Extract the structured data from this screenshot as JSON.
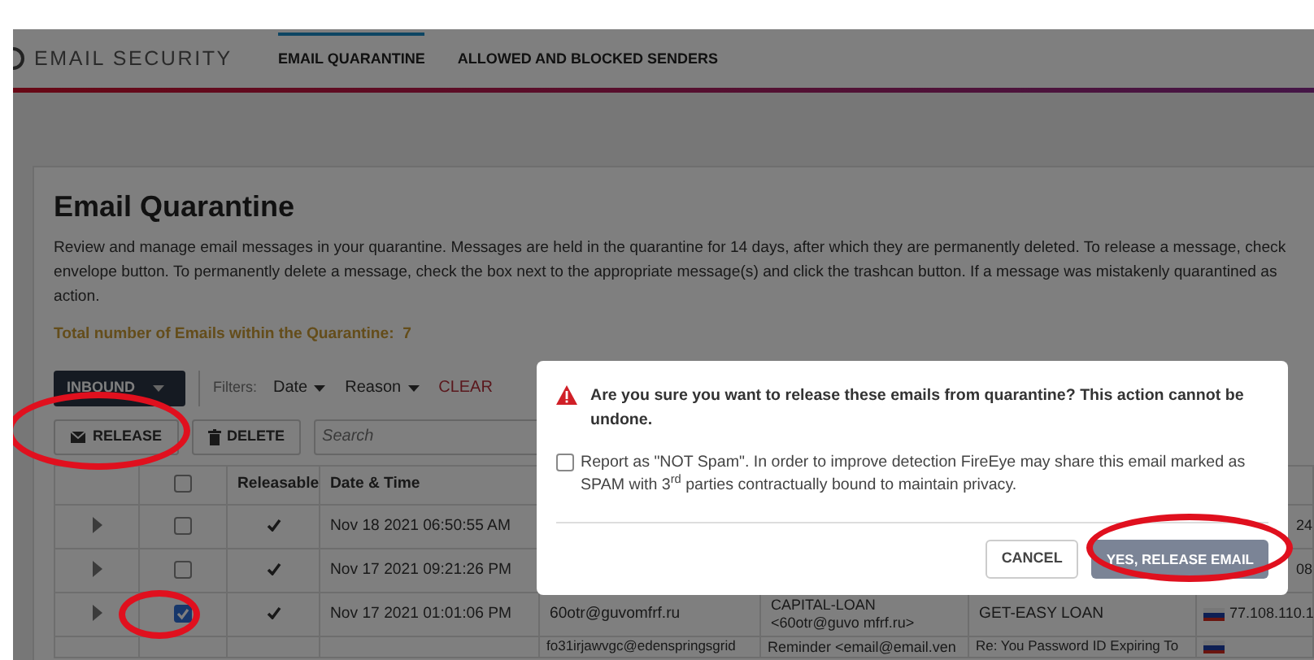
{
  "header": {
    "logo_text": "EMAIL SECURITY",
    "tabs": [
      {
        "label": "EMAIL QUARANTINE",
        "selected": true
      },
      {
        "label": "ALLOWED AND BLOCKED SENDERS",
        "selected": false
      }
    ]
  },
  "page": {
    "title": "Email Quarantine",
    "description_lines": [
      "Review and manage email messages in your quarantine. Messages are held in the quarantine for 14 days, after which they are permanently deleted. To release a message, check",
      "envelope button. To permanently delete a message, check the box next to the appropriate message(s) and click the trashcan button. If a message was mistakenly quarantined as",
      "action."
    ],
    "total_label": "Total number of Emails within the Quarantine:",
    "total_value": "7"
  },
  "toolbar": {
    "direction": "INBOUND",
    "filters_label": "Filters:",
    "filters": [
      "Date",
      "Reason"
    ],
    "clear": "CLEAR",
    "release": "RELEASE",
    "delete": "DELETE",
    "search_placeholder": "Search"
  },
  "table": {
    "columns": [
      "Releasable",
      "Date & Time"
    ],
    "select_all_checked": false,
    "rows": [
      {
        "checked": false,
        "releasable": true,
        "date": "Nov 18 2021 06:50:55 AM",
        "ip": "24"
      },
      {
        "checked": false,
        "releasable": true,
        "date": "Nov 17 2021 09:21:26 PM",
        "ip": "08"
      },
      {
        "checked": true,
        "releasable": true,
        "date": "Nov 17 2021 01:01:06 PM",
        "sender": "60otr@guvomfrf.ru",
        "from": "CAPITAL-LOAN <60otr@guvo mfrf.ru>",
        "subject": "GET-EASY LOAN",
        "ip": "77.108.110.1"
      },
      {
        "sender": "fo31irjawvgc@edenspringsgrid",
        "from": "Reminder <email@email.ven",
        "subject": "Re: You Password ID Expiring To"
      }
    ]
  },
  "dialog": {
    "message": "Are you sure you want to release these emails from quarantine? This action cannot be undone.",
    "report_checked": false,
    "report_label": "Report as \"NOT Spam\". In order to improve detection FireEye may share this email marked as SPAM with 3$^{rd}$ parties contractually bound to maintain privacy.",
    "cancel": "CANCEL",
    "confirm": "YES, RELEASE EMAIL"
  }
}
